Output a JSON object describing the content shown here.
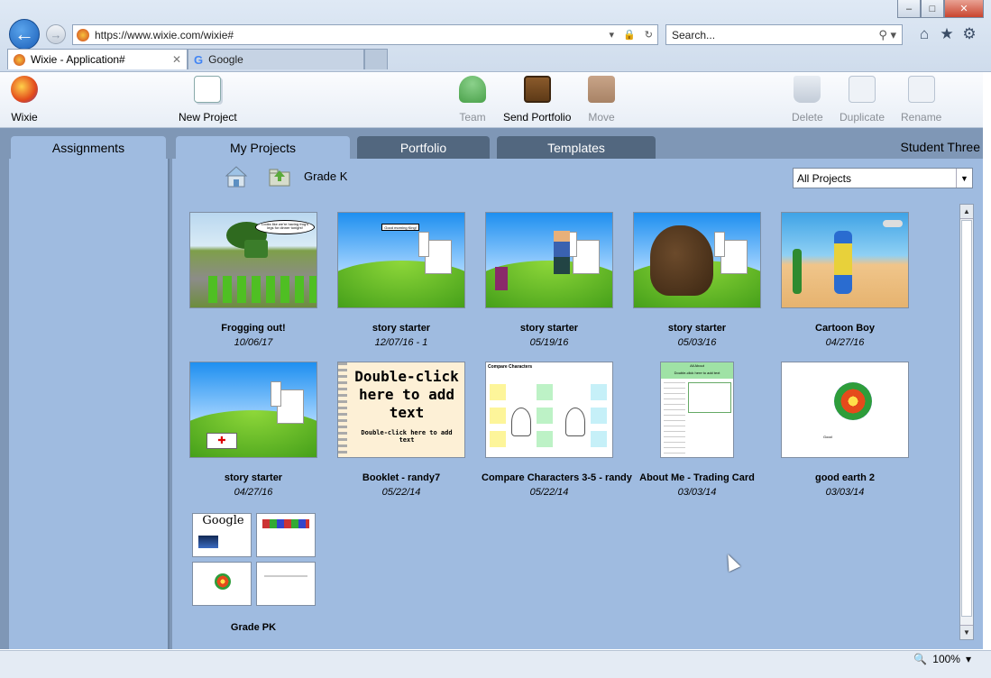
{
  "browser": {
    "address_url": "https://www.wixie.com/wixie#",
    "search_placeholder": "Search...",
    "tabs": [
      {
        "label": "Wixie - Application#"
      },
      {
        "label": "Google"
      }
    ],
    "zoom": "100%"
  },
  "toolbar": {
    "wixie_label": "Wixie",
    "new_project_label": "New Project",
    "team_label": "Team",
    "send_portfolio_label": "Send Portfolio",
    "move_label": "Move",
    "delete_label": "Delete",
    "duplicate_label": "Duplicate",
    "rename_label": "Rename"
  },
  "app_tabs": {
    "assignments": "Assignments",
    "my_projects": "My Projects",
    "portfolio": "Portfolio",
    "templates": "Templates",
    "user": "Student Three"
  },
  "folder": {
    "current": "Grade K",
    "filter_selected": "All Projects"
  },
  "projects": [
    {
      "name": "Frogging out!",
      "date": "10/06/17"
    },
    {
      "name": "story starter",
      "date": "12/07/16 - 1"
    },
    {
      "name": "story starter",
      "date": "05/19/16"
    },
    {
      "name": "story starter",
      "date": "05/03/16"
    },
    {
      "name": "Cartoon Boy",
      "date": "04/27/16"
    },
    {
      "name": "story starter",
      "date": "04/27/16"
    },
    {
      "name": "Booklet - randy7",
      "date": "05/22/14"
    },
    {
      "name": "Compare Characters 3-5 - randy",
      "date": "05/22/14"
    },
    {
      "name": "About Me - Trading Card",
      "date": "03/03/14"
    },
    {
      "name": "good earth 2",
      "date": "03/03/14"
    },
    {
      "name": "Grade PK",
      "date": ""
    }
  ],
  "thumb_text": {
    "frog_bubble": "Looks like we're having frog's legs for dinner tonight!",
    "morning": "Good morning King!",
    "booklet_big": "Double-click here to add text",
    "booklet_small": "Double-click here to add text",
    "compare_title": "Compare Characters",
    "aboutme_title": "All About",
    "aboutme_sub": "Double-click here to add text",
    "earth_label": "Good",
    "google_word": "Google"
  }
}
